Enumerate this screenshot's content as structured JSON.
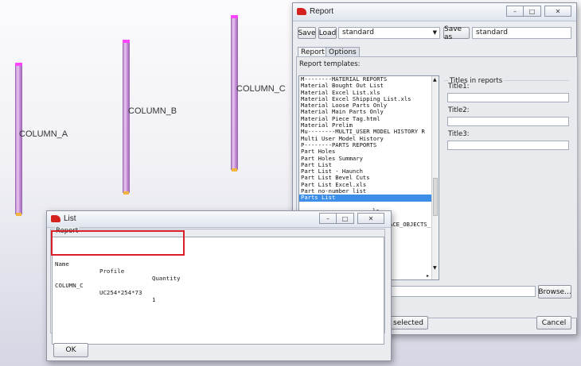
{
  "viewport": {
    "columns": [
      {
        "label": "COLUMN_A"
      },
      {
        "label": "COLUMN_B"
      },
      {
        "label": "COLUMN_C"
      }
    ]
  },
  "report_window": {
    "title": "Report",
    "toolbar": {
      "save_label": "Save",
      "load_label": "Load",
      "load_value": "standard",
      "save_as_label": "Save as",
      "save_as_value": "standard"
    },
    "tabs": [
      {
        "label": "Report",
        "active": true
      },
      {
        "label": "Options",
        "active": false
      }
    ],
    "templates_label": "Report templates:",
    "templates": [
      "M--------MATERIAL REPORTS",
      "Material Bought Out List",
      "Material Excel List.xls",
      "Material Excel Shipping List.xls",
      "Material Loose Parts Only",
      "Material Main Parts Only",
      "Material Piece Tag.html",
      "Material Prelim",
      "Mu--------MULTI_USER MODEL HISTORY R",
      "Multi User Model History",
      "P--------PARTS REPORTS",
      "Part Holes",
      "Part Holes Summary",
      "Part List",
      "Part List - Haunch",
      "Part List Bevel Cuts",
      "Part List Excel.xls",
      "Part no-number list",
      "Parts List",
      "",
      "ls",
      "",
      "ACE_OBJECTS_",
      "",
      "",
      "",
      ""
    ],
    "selected_template": "Parts List",
    "titles_legend": "Titles in reports",
    "title_fields": [
      {
        "label": "Title1:",
        "value": ""
      },
      {
        "label": "Title2:",
        "value": ""
      },
      {
        "label": "Title3:",
        "value": ""
      }
    ],
    "browse_label": "Browse...",
    "partial_selected_label": "selected",
    "cancel_label": "Cancel"
  },
  "list_window": {
    "title": "List",
    "group_label": "Report",
    "columns": [
      "Name",
      "Profile",
      "Quantity"
    ],
    "rows": [
      {
        "name": "COLUMN_C",
        "profile": "UC254*254*73",
        "quantity": "1"
      }
    ],
    "ok_label": "OK"
  },
  "colors": {
    "selection": "#3d8ee9",
    "highlight_box": "#d81f2a",
    "column_body": "#d9aee5",
    "app_icon": "#d4231f"
  }
}
